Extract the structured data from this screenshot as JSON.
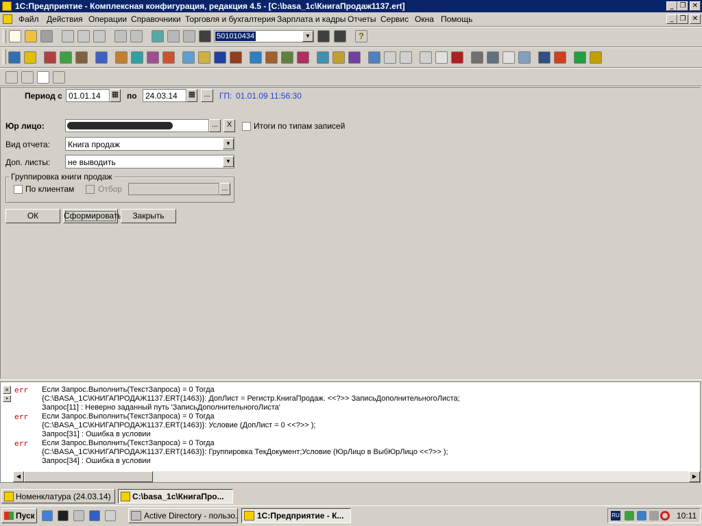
{
  "window": {
    "title": "1С:Предприятие - Комплексная конфигурация, редакция 4.5 - [C:\\basa_1c\\КнигаПродаж1137.ert]"
  },
  "menu": [
    "Файл",
    "Действия",
    "Операции",
    "Справочники",
    "Торговля и бухгалтерия",
    "Зарплата и кадры",
    "Отчеты",
    "Сервис",
    "Окна",
    "Помощь"
  ],
  "toolbar": {
    "search_value": "501010434",
    "help_glyph": "?"
  },
  "form": {
    "period_label": "Период с",
    "period_from": "01.01.14",
    "period_to_label": "по",
    "period_to": "24.03.14",
    "ellipsis": "...",
    "gp_label": "ГП:",
    "gp_value": "01.01.09 11:56:30",
    "legal_label": "Юр лицо:",
    "legal_clear": "X",
    "totals_label": "Итоги по типам записей",
    "report_type_label": "Вид отчета:",
    "report_type_value": "Книга продаж",
    "extra_sheets_label": "Доп. листы:",
    "extra_sheets_value": "не выводить",
    "group_title": "Группировка книги продаж",
    "by_clients_label": "По клиентам",
    "filter_label": "Отбор",
    "ok_label": "ОК",
    "generate_label": "Сформировать",
    "close_label": "Закрыть"
  },
  "messages": {
    "blocks": [
      {
        "tag": "err",
        "lines": [
          "Если Запрос.Выполнить(ТекстЗапроса) = 0 Тогда",
          "{C:\\BASA_1C\\КНИГАПРОДАЖ1137.ERT(1463)}: ДопЛист              = Регистр.КнигаПродаж. <<?>> ЗаписьДополнительногоЛиста;",
          "Запрос[11] : Неверно заданный путь 'ЗаписьДополнительногоЛиста'"
        ]
      },
      {
        "tag": "err",
        "lines": [
          "Если Запрос.Выполнить(ТекстЗапроса) = 0 Тогда",
          "{C:\\BASA_1C\\КНИГАПРОДАЖ1137.ERT(1463)}: Условие (ДопЛист = 0 <<?>> );",
          "Запрос[31] : Ошибка в условии"
        ]
      },
      {
        "tag": "err",
        "lines": [
          "Если Запрос.Выполнить(ТекстЗапроса) = 0 Тогда",
          "{C:\\BASA_1C\\КНИГАПРОДАЖ1137.ERT(1463)}: Группировка ТекДокумент;Условие (ЮрЛицо в ВыбЮрЛицо <<?>> );",
          "Запрос[34] : Ошибка в условии"
        ]
      }
    ]
  },
  "mdi_tabs": [
    {
      "label": "Номенклатура (24.03.14)"
    },
    {
      "label": "C:\\basa_1c\\КнигаПро..."
    }
  ],
  "taskbar": {
    "start_label": "Пуск",
    "items": [
      {
        "label": "Active Directory - пользо..."
      },
      {
        "label": "1С:Предприятие - К..."
      }
    ],
    "tray_lang": "RU",
    "clock": "10:11"
  },
  "colors": {
    "titlebar": "#0a246a",
    "gp_text": "#1f3fd0",
    "err_text": "#c00000"
  }
}
